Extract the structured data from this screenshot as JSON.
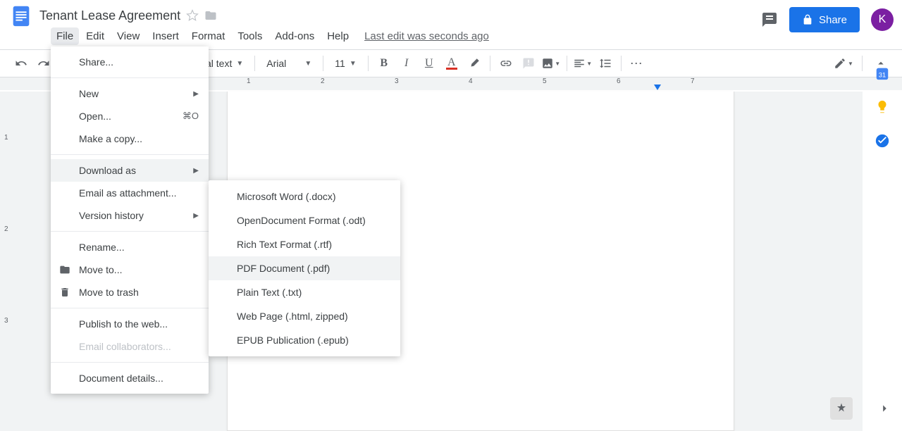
{
  "document": {
    "title": "Tenant Lease Agreement",
    "last_edit": "Last edit was seconds ago"
  },
  "menu": [
    "File",
    "Edit",
    "View",
    "Insert",
    "Format",
    "Tools",
    "Add-ons",
    "Help"
  ],
  "share_label": "Share",
  "avatar_letter": "K",
  "toolbar": {
    "style": "al text",
    "font": "Arial",
    "size": "11"
  },
  "file_menu": {
    "share": "Share...",
    "new": "New",
    "open": "Open...",
    "open_shortcut": "⌘O",
    "copy": "Make a copy...",
    "download": "Download as",
    "email_attach": "Email as attachment...",
    "version": "Version history",
    "rename": "Rename...",
    "move": "Move to...",
    "trash": "Move to trash",
    "publish": "Publish to the web...",
    "email_collab": "Email collaborators...",
    "details": "Document details..."
  },
  "download_menu": {
    "docx": "Microsoft Word (.docx)",
    "odt": "OpenDocument Format (.odt)",
    "rtf": "Rich Text Format (.rtf)",
    "pdf": "PDF Document (.pdf)",
    "txt": "Plain Text (.txt)",
    "html": "Web Page (.html, zipped)",
    "epub": "EPUB Publication (.epub)"
  }
}
